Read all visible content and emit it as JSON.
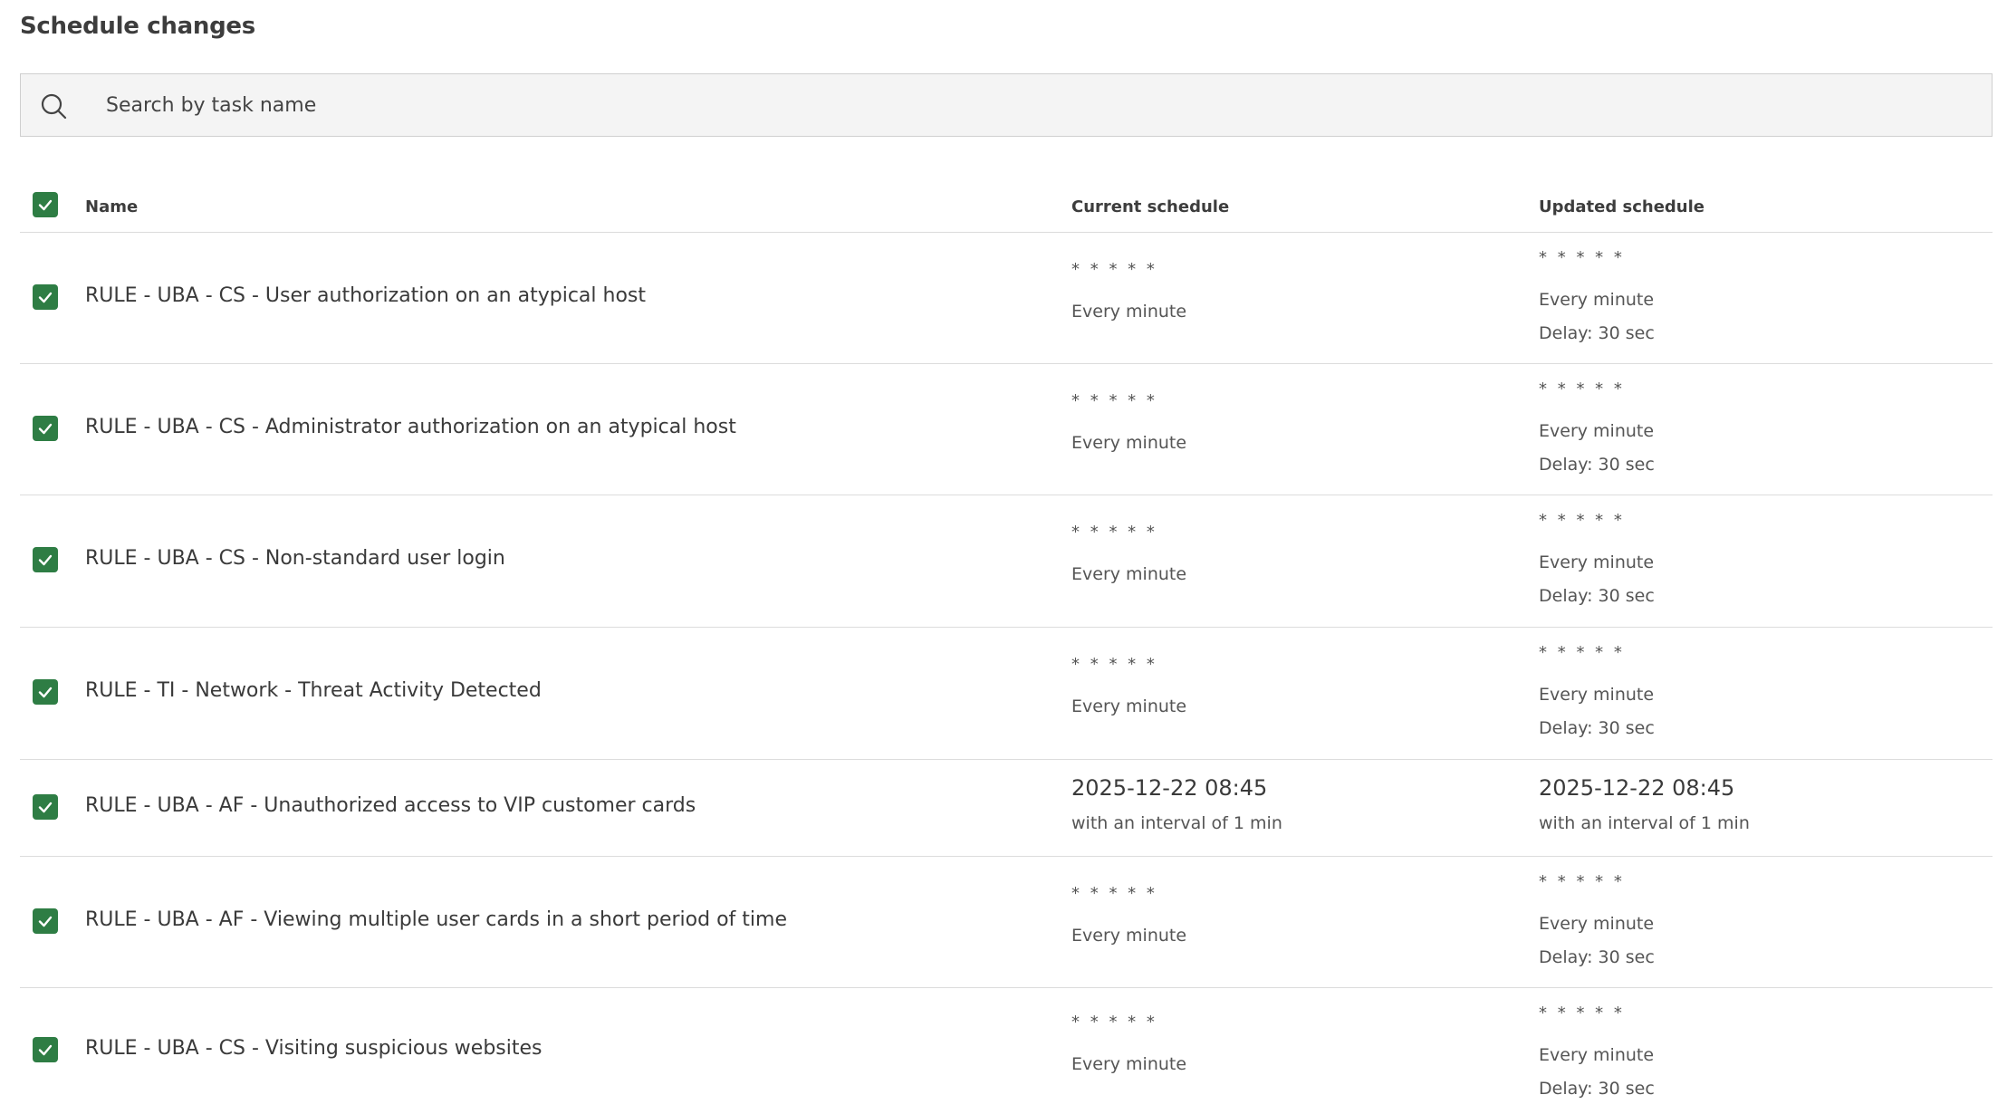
{
  "page": {
    "title": "Schedule changes"
  },
  "search": {
    "placeholder": "Search by task name",
    "value": ""
  },
  "table": {
    "columns": {
      "name": "Name",
      "current": "Current schedule",
      "updated": "Updated schedule"
    },
    "select_all_checked": true,
    "rows": [
      {
        "checked": true,
        "name": "RULE - UBA - CS - User authorization on an atypical host",
        "current": [
          "* * * * *",
          "Every minute"
        ],
        "updated": [
          "* * * * *",
          "Every minute",
          "Delay: 30 sec"
        ]
      },
      {
        "checked": true,
        "name": "RULE - UBA - CS - Administrator authorization on an atypical host",
        "current": [
          "* * * * *",
          "Every minute"
        ],
        "updated": [
          "* * * * *",
          "Every minute",
          "Delay: 30 sec"
        ]
      },
      {
        "checked": true,
        "name": "RULE - UBA - CS - Non-standard user login",
        "current": [
          "* * * * *",
          "Every minute"
        ],
        "updated": [
          "* * * * *",
          "Every minute",
          "Delay: 30 sec"
        ]
      },
      {
        "checked": true,
        "name": "RULE - TI - Network - Threat Activity Detected",
        "current": [
          "* * * * *",
          "Every minute"
        ],
        "updated": [
          "* * * * *",
          "Every minute",
          "Delay: 30 sec"
        ]
      },
      {
        "checked": true,
        "name": "RULE - UBA - AF - Unauthorized access to VIP customer cards",
        "current": [
          "2025-12-22 08:45",
          "with an interval of 1 min"
        ],
        "updated": [
          "2025-12-22 08:45",
          "with an interval of 1 min"
        ]
      },
      {
        "checked": true,
        "name": "RULE - UBA - AF - Viewing multiple user cards in a short period of time",
        "current": [
          "* * * * *",
          "Every minute"
        ],
        "updated": [
          "* * * * *",
          "Every minute",
          "Delay: 30 sec"
        ]
      },
      {
        "checked": true,
        "name": "RULE - UBA - CS - Visiting suspicious websites",
        "current": [
          "* * * * *",
          "Every minute"
        ],
        "updated": [
          "* * * * *",
          "Every minute",
          "Delay: 30 sec"
        ]
      }
    ]
  },
  "colors": {
    "checkbox": "#2e7d44",
    "border": "#dcdcdc",
    "search_bg": "#f4f4f4"
  }
}
